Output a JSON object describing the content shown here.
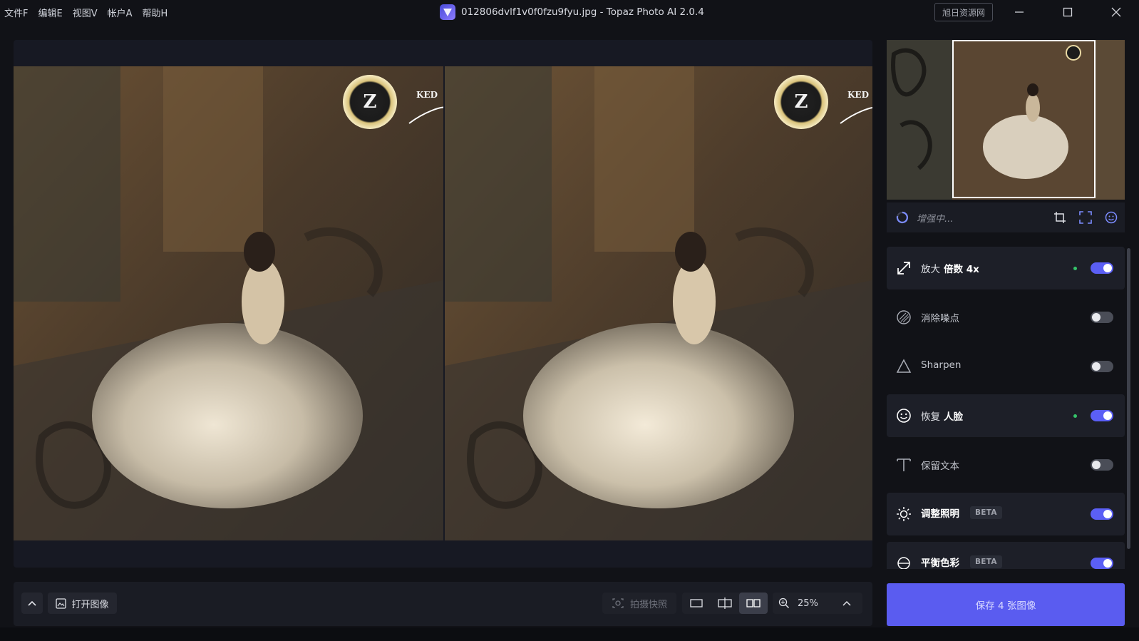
{
  "titlebar": {
    "menu": [
      "文件F",
      "编辑E",
      "视图V",
      "帐户A",
      "帮助H"
    ],
    "title": "012806dvlf1v0f0fzu9fyu.jpg - Topaz Photo AI 2.0.4",
    "watermark": "旭日资源网",
    "icons": [
      "minimize-icon",
      "maximize-icon",
      "close-icon"
    ]
  },
  "canvas": {
    "left_image_alt": "原始图像",
    "right_image_alt": "增强图像",
    "logo_text": "KED"
  },
  "bottombar": {
    "open_label": "打开图像",
    "snapshot_label": "拍摄快照",
    "zoom": "25%"
  },
  "panel": {
    "status": "增强中...",
    "features": [
      {
        "label": "放大",
        "emph": "倍数 4x",
        "enabled": true,
        "active": true,
        "icon": "upscale-icon"
      },
      {
        "label": "消除噪点",
        "emph": "",
        "enabled": false,
        "active": false,
        "icon": "denoise-icon"
      },
      {
        "label": "Sharpen",
        "emph": "",
        "enabled": false,
        "active": false,
        "icon": "sharpen-icon"
      },
      {
        "label": "恢复",
        "emph": "人脸",
        "enabled": true,
        "active": true,
        "icon": "face-icon"
      },
      {
        "label": "保留文本",
        "emph": "",
        "enabled": false,
        "active": false,
        "icon": "text-icon"
      },
      {
        "label": "调整照明",
        "emph": "",
        "badge": "BETA",
        "enabled": true,
        "active": false,
        "icon": "sun-icon"
      },
      {
        "label": "平衡色彩",
        "emph": "",
        "badge": "BETA",
        "enabled": true,
        "active": false,
        "icon": "color-balance-icon"
      }
    ],
    "save_label": "保存 4 张图像"
  },
  "colors": {
    "accent": "#5b5ff5",
    "active_dot": "#35c46a",
    "background": "#111217"
  }
}
